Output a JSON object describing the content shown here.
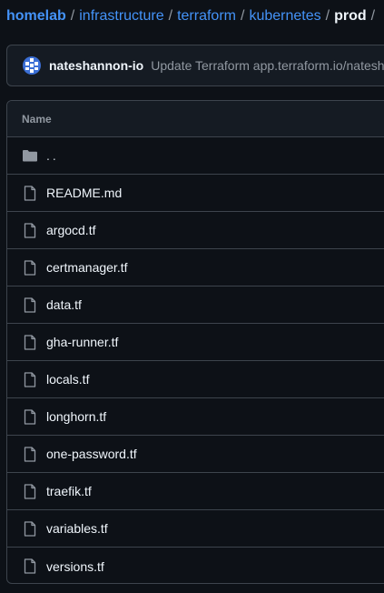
{
  "breadcrumb": {
    "repo": "homelab",
    "path": [
      "infrastructure",
      "terraform",
      "kubernetes"
    ],
    "current": "prod",
    "separator": "/"
  },
  "commit": {
    "author": "nateshannon-io",
    "message": "Update Terraform app.terraform.io/nateshannon-io/..."
  },
  "table": {
    "header": "Name",
    "parent_dir": "..",
    "files": [
      "README.md",
      "argocd.tf",
      "certmanager.tf",
      "data.tf",
      "gha-runner.tf",
      "locals.tf",
      "longhorn.tf",
      "one-password.tf",
      "traefik.tf",
      "variables.tf",
      "versions.tf"
    ]
  },
  "colors": {
    "background": "#0d1117",
    "link": "#4493f8",
    "text": "#f0f6fc",
    "muted": "#9198a1",
    "border": "#3d444d",
    "avatar": "#3b6fd6"
  },
  "icons": {
    "folder": "folder-icon",
    "file": "file-icon",
    "avatar": "avatar"
  }
}
